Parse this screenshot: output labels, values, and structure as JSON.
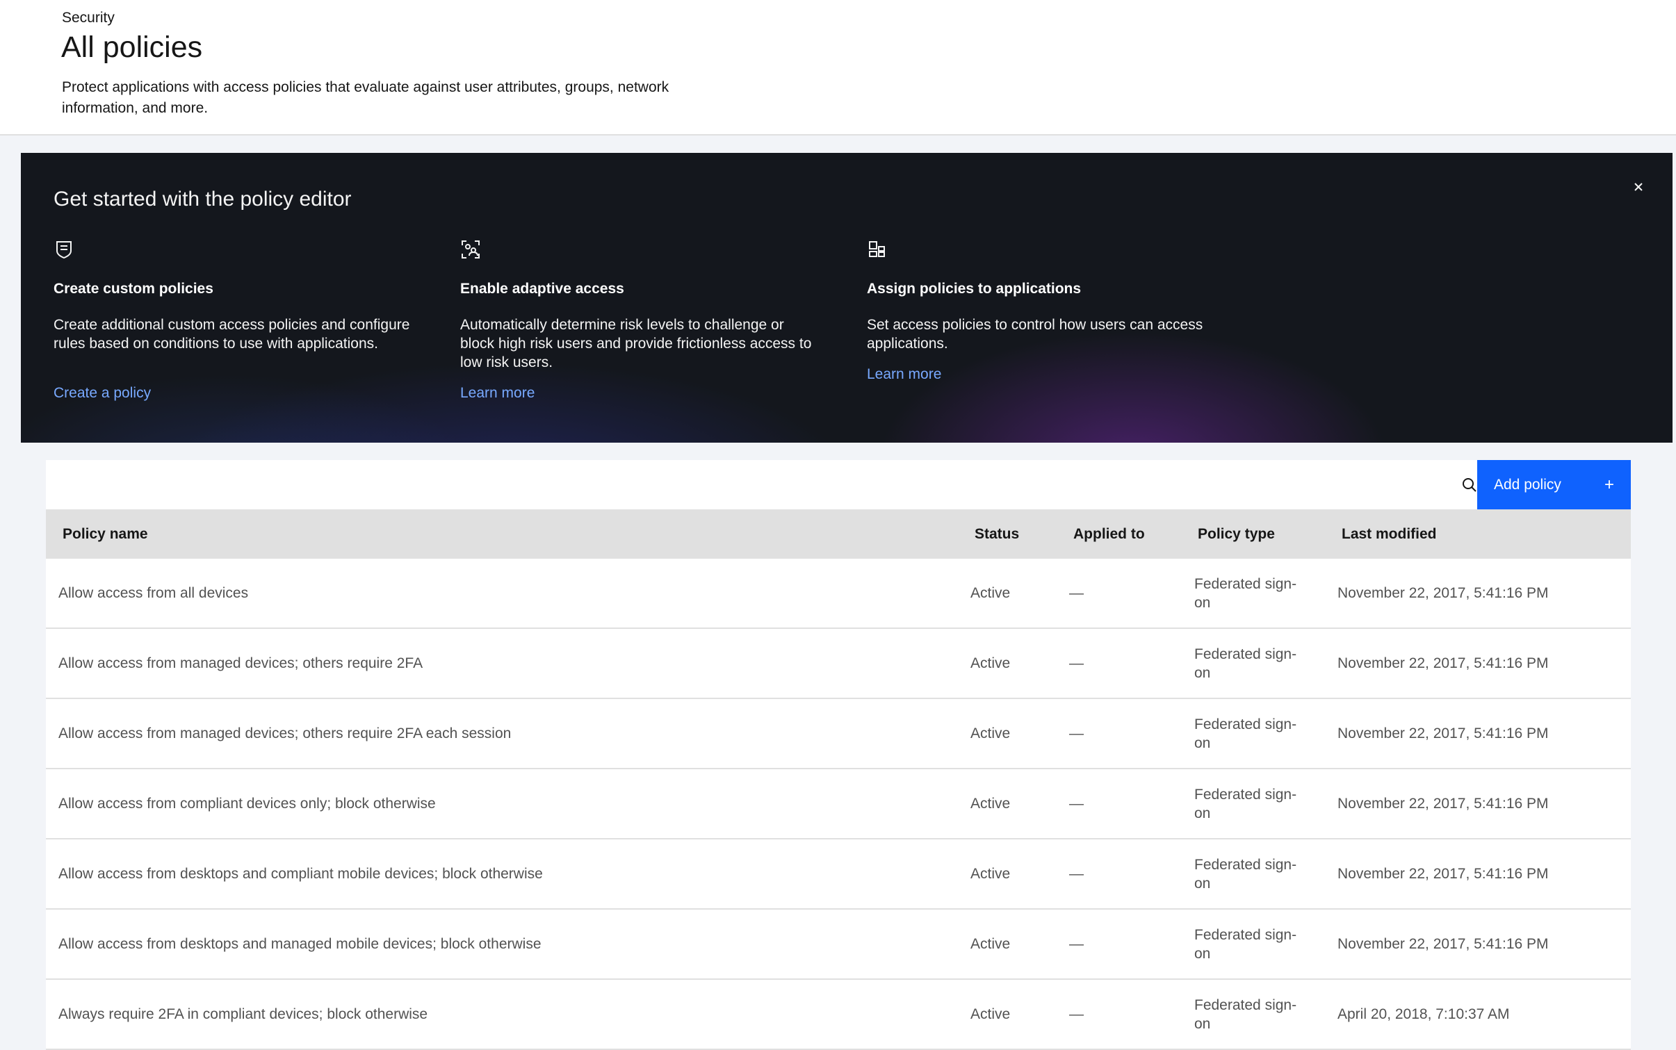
{
  "header": {
    "breadcrumb": "Security",
    "title": "All policies",
    "description": "Protect applications with access policies that evaluate against user attributes, groups, network information, and more."
  },
  "banner": {
    "title": "Get started with the policy editor",
    "close_icon": "close-icon",
    "features": [
      {
        "icon": "policy-document-icon",
        "heading": "Create custom policies",
        "description": "Create additional custom access policies and configure rules based on conditions to use with applications.",
        "link": "Create a policy"
      },
      {
        "icon": "user-identification-icon",
        "heading": "Enable adaptive access",
        "description": "Automatically determine risk levels to challenge or block high risk users and provide frictionless access to low risk users.",
        "link": "Learn more"
      },
      {
        "icon": "apps-icon",
        "heading": "Assign policies to applications",
        "description": "Set access policies to control how users can access applications.",
        "link": "Learn more"
      }
    ]
  },
  "toolbar": {
    "search_icon": "search-icon",
    "add_label": "Add policy",
    "add_icon": "+"
  },
  "table": {
    "columns": [
      "Policy name",
      "Status",
      "Applied to",
      "Policy type",
      "Last modified"
    ],
    "rows": [
      {
        "name": "Allow access from all devices",
        "status": "Active",
        "applied": "—",
        "type": "Federated sign-on",
        "modified": "November 22, 2017, 5:41:16 PM"
      },
      {
        "name": "Allow access from managed devices; others require 2FA",
        "status": "Active",
        "applied": "—",
        "type": "Federated sign-on",
        "modified": "November 22, 2017, 5:41:16 PM"
      },
      {
        "name": "Allow access from managed devices; others require 2FA each session",
        "status": "Active",
        "applied": "—",
        "type": "Federated sign-on",
        "modified": "November 22, 2017, 5:41:16 PM"
      },
      {
        "name": "Allow access from compliant devices only; block otherwise",
        "status": "Active",
        "applied": "—",
        "type": "Federated sign-on",
        "modified": "November 22, 2017, 5:41:16 PM"
      },
      {
        "name": "Allow access from desktops and compliant mobile devices; block otherwise",
        "status": "Active",
        "applied": "—",
        "type": "Federated sign-on",
        "modified": "November 22, 2017, 5:41:16 PM"
      },
      {
        "name": "Allow access from desktops and managed mobile devices; block otherwise",
        "status": "Active",
        "applied": "—",
        "type": "Federated sign-on",
        "modified": "November 22, 2017, 5:41:16 PM"
      },
      {
        "name": "Always require 2FA in compliant devices; block otherwise",
        "status": "Active",
        "applied": "—",
        "type": "Federated sign-on",
        "modified": "April 20, 2018, 7:10:37 AM"
      }
    ]
  },
  "colors": {
    "primary_button": "#0f62fe",
    "banner_link": "#78a9ff",
    "banner_bg": "#14171d"
  }
}
